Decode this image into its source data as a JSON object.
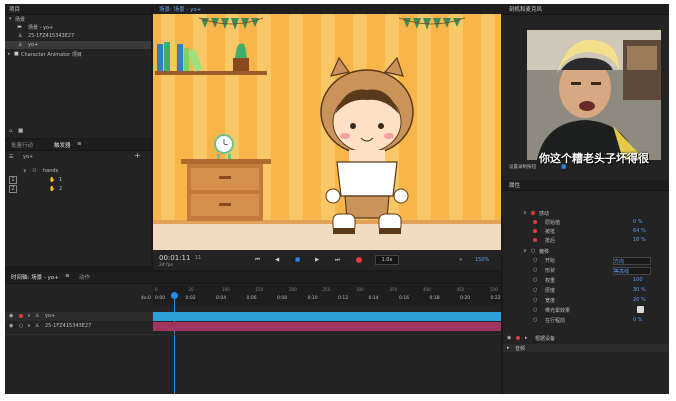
{
  "project_panel": {
    "title": "项目",
    "items": [
      {
        "icon": "folder-icon",
        "label": "场景"
      },
      {
        "icon": "scene-icon",
        "label": "场景 - yo+"
      },
      {
        "icon": "puppet-icon",
        "label": "25-1FZ415343E27"
      },
      {
        "icon": "puppet-icon",
        "label": "yo+"
      },
      {
        "icon": "folder-icon",
        "label": "Character Animator 项目"
      }
    ]
  },
  "triggers_panel": {
    "tabs": [
      "批量行动",
      "触发器"
    ],
    "active_tab": 1,
    "root_label": "yo+",
    "group_label": "hands",
    "rows": [
      {
        "key": "1",
        "value": "1"
      },
      {
        "key": "2",
        "value": "2"
      }
    ]
  },
  "stage": {
    "tab": "场景: 场景 - yo+",
    "timecode": "00:01:11",
    "frame": "11",
    "fps": "24 fps",
    "speed": "1.0x",
    "zoom": "150%"
  },
  "timeline": {
    "tabs": [
      "时间轴: 场景 - yo+",
      "动作"
    ],
    "ruler_labels": [
      "0:00",
      "0:02",
      "0:04",
      "0:06",
      "0:08",
      "0:10",
      "0:12",
      "0:14",
      "0:16",
      "0:18",
      "0:20",
      "0:22"
    ],
    "ruler_top_labels": [
      "0",
      "20",
      "100",
      "150",
      "200",
      "250",
      "300",
      "350",
      "400",
      "450",
      "500"
    ],
    "ruler_left_label": "4x:0",
    "tracks": [
      {
        "name": "yo+",
        "color": "#2f9fd8"
      },
      {
        "name": "25-1FZ415343E27",
        "color": "#a0355f"
      }
    ]
  },
  "right_panel": {
    "header": "刻机和麦克风",
    "video_caption": "你这个糟老头子坏得很",
    "under_video_label": "设置录制按钮",
    "properties_title": "属性",
    "properties": [
      {
        "label": "感动",
        "value": "",
        "section": true
      },
      {
        "label": "原始值",
        "value": "0 %"
      },
      {
        "label": "被抵",
        "value": "64 %"
      },
      {
        "label": "抵后",
        "value": "16 %"
      },
      {
        "label": "偏移",
        "value": "",
        "section": true
      },
      {
        "label": "开始",
        "value": "方向"
      },
      {
        "label": "形状",
        "value": "等高线"
      },
      {
        "label": "权重",
        "value": "100"
      },
      {
        "label": "厚度",
        "value": "30 %"
      },
      {
        "label": "宽度",
        "value": "20 %"
      },
      {
        "label": "带光晕效果",
        "value": ""
      },
      {
        "label": "在行程前",
        "value": "0 %"
      }
    ],
    "bottom_items": [
      "根据设备",
      "音频"
    ]
  }
}
